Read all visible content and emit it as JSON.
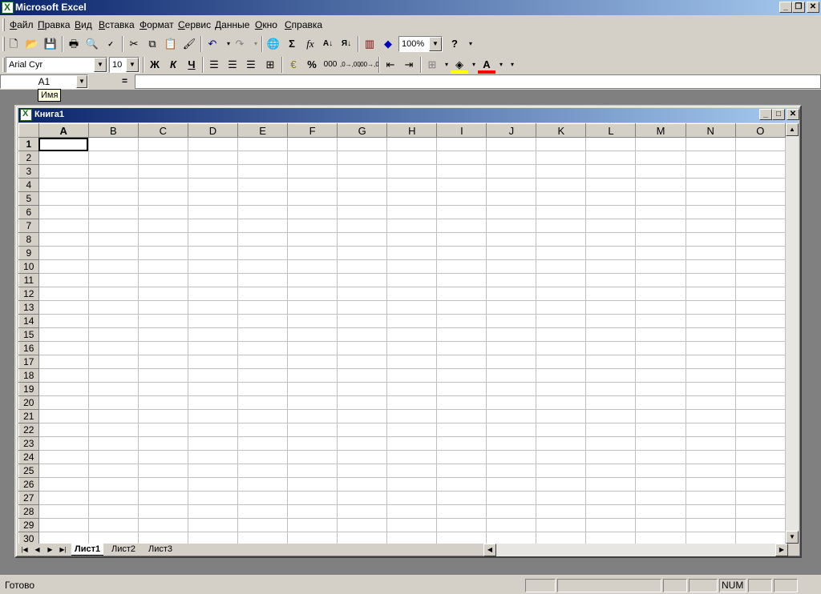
{
  "window": {
    "title": "Microsoft Excel"
  },
  "menu": [
    "Файл",
    "Правка",
    "Вид",
    "Вставка",
    "Формат",
    "Сервис",
    "Данные",
    "Окно",
    "Справка"
  ],
  "standard_toolbar": {
    "zoom": "100%"
  },
  "format_toolbar": {
    "font": "Arial Cyr",
    "size": "10",
    "bold": "Ж",
    "italic": "К",
    "underline": "Ч",
    "percent": "%",
    "thousands": "000",
    "inc_dec": ",0→,00",
    "dec_dec": ",00→,0"
  },
  "formula_bar": {
    "name_box": "A1",
    "equals": "=",
    "tooltip": "Имя"
  },
  "workbook": {
    "title": "Книга1",
    "columns": [
      "A",
      "B",
      "C",
      "D",
      "E",
      "F",
      "G",
      "H",
      "I",
      "J",
      "K",
      "L",
      "M",
      "N",
      "O"
    ],
    "rows": [
      "1",
      "2",
      "3",
      "4",
      "5",
      "6",
      "7",
      "8",
      "9",
      "10",
      "11",
      "12",
      "13",
      "14",
      "15",
      "16",
      "17",
      "18",
      "19",
      "20",
      "21",
      "22",
      "23",
      "24",
      "25",
      "26",
      "27",
      "28",
      "29",
      "30"
    ],
    "active_cell": "A1",
    "sheets": [
      "Лист1",
      "Лист2",
      "Лист3"
    ],
    "active_sheet": "Лист1"
  },
  "status": {
    "text": "Готово",
    "num": "NUM"
  },
  "colors": {
    "title_start": "#0a246a",
    "title_end": "#a6caf0",
    "face": "#d4d0c8",
    "mdi_bg": "#808080"
  }
}
